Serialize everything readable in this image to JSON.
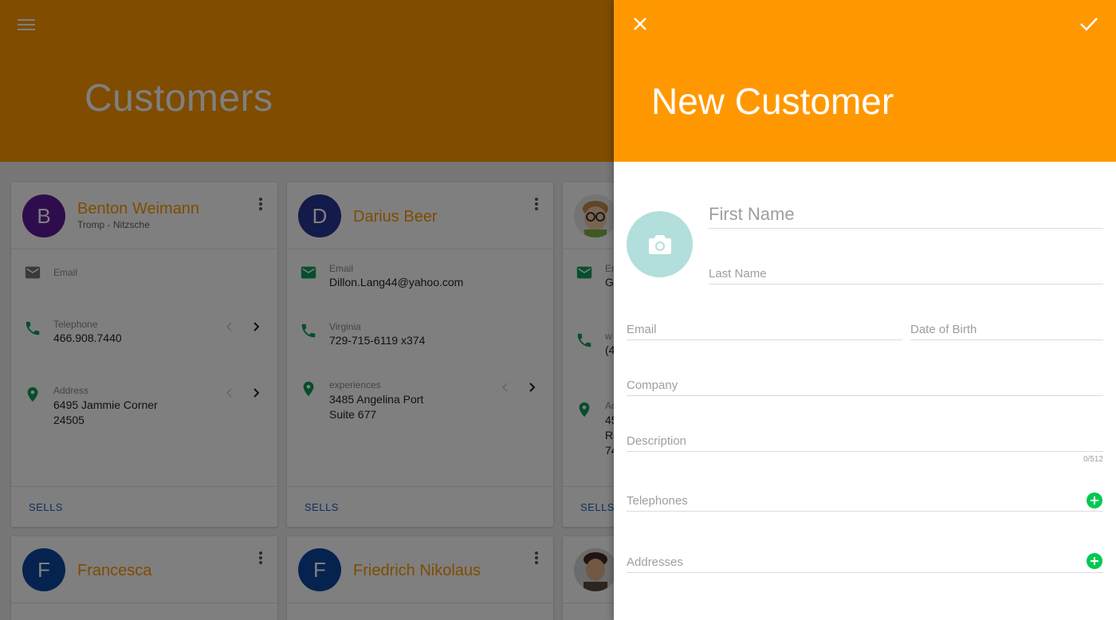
{
  "app": {
    "title": "Customers",
    "menu_icon": "menu-icon"
  },
  "colors": {
    "accent": "#ff9800",
    "link": "#1e5fc1",
    "icon_green": "#0f9d58",
    "add_green": "#00c853",
    "photo_bg": "#b2dfdb"
  },
  "cards": [
    {
      "initial": "B",
      "avatar_color": "#5e1b9b",
      "name": "Benton Weimann",
      "company": "Tromp - Nitzsche",
      "email_label": "Email",
      "email_value": "",
      "phone_label": "Telephone",
      "phone_value": "466.908.7440",
      "address_label": "Address",
      "address_line1": "6495 Jammie Corner",
      "address_line2": "24505",
      "action": "SELLS"
    },
    {
      "initial": "D",
      "avatar_color": "#283593",
      "name": "Darius Beer",
      "company": "",
      "email_label": "Email",
      "email_value": "Dillon.Lang44@yahoo.com",
      "phone_label": "Virginia",
      "phone_value": "729-715-6119 x374",
      "address_label": "experiences",
      "address_line1": "3485 Angelina Port",
      "address_line2": "Suite 677",
      "action": "SELLS"
    },
    {
      "initial": "",
      "avatar_color": "#e0e0e0",
      "name": "",
      "company": "",
      "email_label": "Em",
      "email_value": "Gi",
      "phone_label": "w",
      "phone_value": "(4",
      "address_label": "Ad",
      "address_line1": "45",
      "address_line2": "Ro",
      "address_line3": "74",
      "action": "SELLS"
    },
    {
      "initial": "F",
      "avatar_color": "#0d47a1",
      "name": "Francesca"
    },
    {
      "initial": "F",
      "avatar_color": "#0d47a1",
      "name": "Friedrich Nikolaus"
    }
  ],
  "dialog": {
    "title": "New Customer",
    "close_icon": "close-icon",
    "confirm_icon": "check-icon",
    "photo_icon": "camera-icon",
    "fields": {
      "first_name": "First Name",
      "last_name": "Last Name",
      "email": "Email",
      "date_of_birth": "Date of Birth",
      "company": "Company",
      "description": "Description",
      "description_counter": "0/512",
      "telephones": "Telephones",
      "addresses": "Addresses"
    }
  }
}
